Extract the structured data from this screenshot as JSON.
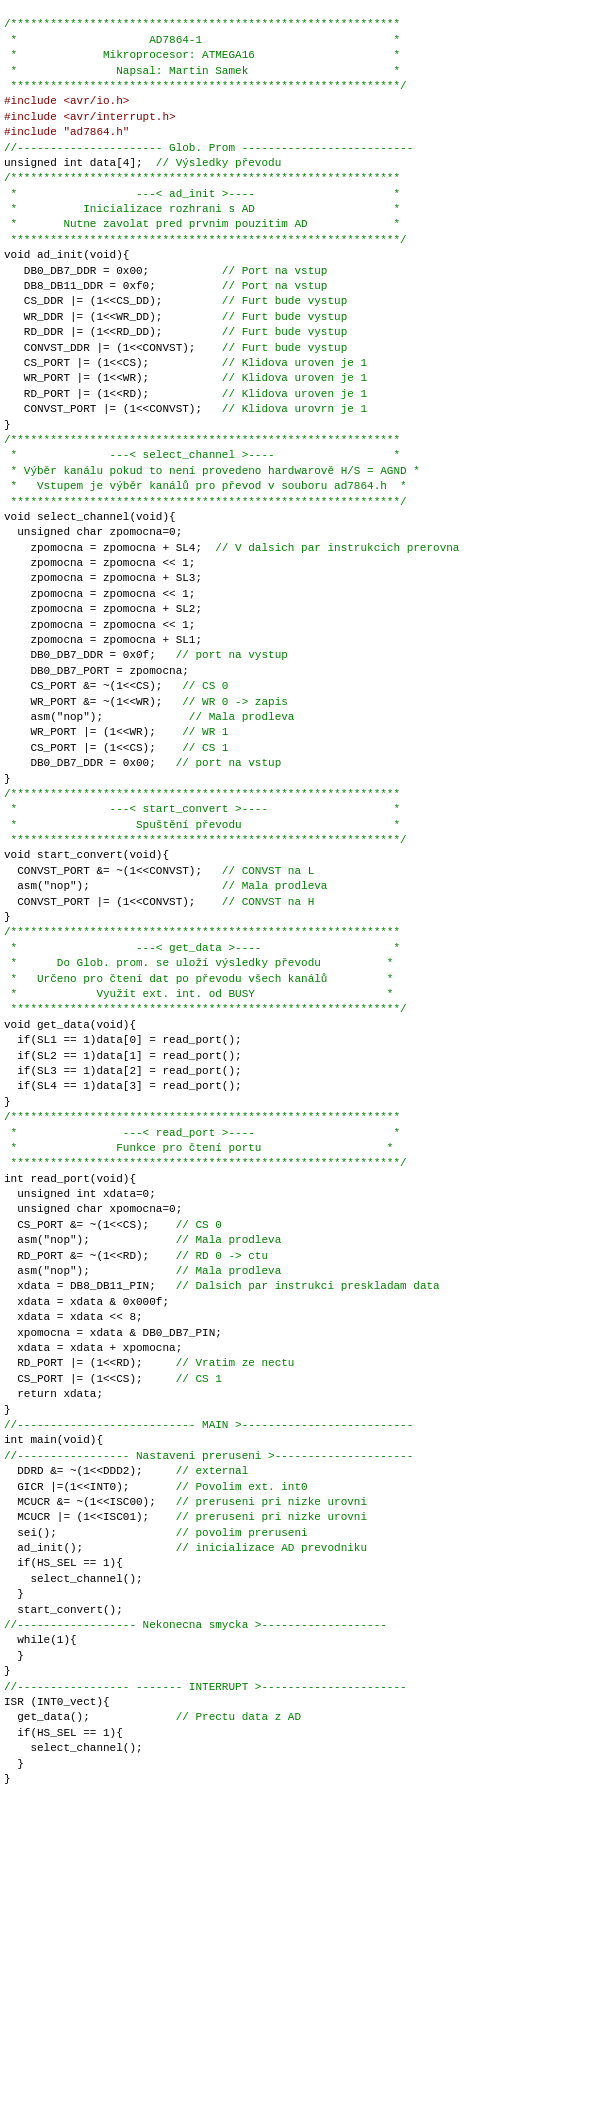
{
  "code": {
    "lines": [
      {
        "text": "/***********************************************************",
        "type": "comment"
      },
      {
        "text": " *                    AD7864-1                             *",
        "type": "comment"
      },
      {
        "text": " *             Mikroprocesor: ATMEGA16                     *",
        "type": "comment"
      },
      {
        "text": " *               Napsal: Martin Samek                      *",
        "type": "comment"
      },
      {
        "text": " ***********************************************************/",
        "type": "comment"
      },
      {
        "text": "#include <avr/io.h>",
        "type": "preprocessor"
      },
      {
        "text": "#include <avr/interrupt.h>",
        "type": "preprocessor"
      },
      {
        "text": "#include \"ad7864.h\"",
        "type": "preprocessor"
      },
      {
        "text": "",
        "type": "normal"
      },
      {
        "text": "//---------------------- Glob. Prom --------------------------",
        "type": "comment"
      },
      {
        "text": "unsigned int data[4];  // Výsledky převodu",
        "type": "normal"
      },
      {
        "text": "",
        "type": "normal"
      },
      {
        "text": "/***********************************************************",
        "type": "comment"
      },
      {
        "text": " *                  ---< ad_init >----                     *",
        "type": "comment"
      },
      {
        "text": " *          Inicializace rozhrani s AD                     *",
        "type": "comment"
      },
      {
        "text": " *       Nutne zavolat pred prvnim pouzitim AD             *",
        "type": "comment"
      },
      {
        "text": " ***********************************************************/",
        "type": "comment"
      },
      {
        "text": "",
        "type": "normal"
      },
      {
        "text": "void ad_init(void){",
        "type": "normal"
      },
      {
        "text": "",
        "type": "normal"
      },
      {
        "text": "   DB0_DB7_DDR = 0x00;           // Port na vstup",
        "type": "normal"
      },
      {
        "text": "   DB8_DB11_DDR = 0xf0;          // Port na vstup",
        "type": "normal"
      },
      {
        "text": "   CS_DDR |= (1<<CS_DD);         // Furt bude vystup",
        "type": "normal"
      },
      {
        "text": "   WR_DDR |= (1<<WR_DD);         // Furt bude vystup",
        "type": "normal"
      },
      {
        "text": "   RD_DDR |= (1<<RD_DD);         // Furt bude vystup",
        "type": "normal"
      },
      {
        "text": "   CONVST_DDR |= (1<<CONVST);    // Furt bude vystup",
        "type": "normal"
      },
      {
        "text": "   CS_PORT |= (1<<CS);           // Klidova uroven je 1",
        "type": "normal"
      },
      {
        "text": "   WR_PORT |= (1<<WR);           // Klidova uroven je 1",
        "type": "normal"
      },
      {
        "text": "   RD_PORT |= (1<<RD);           // Klidova uroven je 1",
        "type": "normal"
      },
      {
        "text": "   CONVST_PORT |= (1<<CONVST);   // Klidova urovrn je 1",
        "type": "normal"
      },
      {
        "text": "}",
        "type": "normal"
      },
      {
        "text": "/***********************************************************",
        "type": "comment"
      },
      {
        "text": " *              ---< select_channel >----                  *",
        "type": "comment"
      },
      {
        "text": " * Výběr kanálu pokud to není provedeno hardwarově H/S = AGND *",
        "type": "comment"
      },
      {
        "text": " *   Vstupem je výběr kanálů pro převod v souboru ad7864.h  *",
        "type": "comment"
      },
      {
        "text": " ***********************************************************/",
        "type": "comment"
      },
      {
        "text": "",
        "type": "normal"
      },
      {
        "text": "void select_channel(void){",
        "type": "normal"
      },
      {
        "text": "",
        "type": "normal"
      },
      {
        "text": "  unsigned char zpomocna=0;",
        "type": "normal"
      },
      {
        "text": "",
        "type": "normal"
      },
      {
        "text": "    zpomocna = zpomocna + SL4;  // V dalsich par instrukcich prerovna",
        "type": "normal"
      },
      {
        "text": "    zpomocna = zpomocna << 1;",
        "type": "normal"
      },
      {
        "text": "    zpomocna = zpomocna + SL3;",
        "type": "normal"
      },
      {
        "text": "    zpomocna = zpomocna << 1;",
        "type": "normal"
      },
      {
        "text": "    zpomocna = zpomocna + SL2;",
        "type": "normal"
      },
      {
        "text": "    zpomocna = zpomocna << 1;",
        "type": "normal"
      },
      {
        "text": "    zpomocna = zpomocna + SL1;",
        "type": "normal"
      },
      {
        "text": "    DB0_DB7_DDR = 0x0f;   // port na vystup",
        "type": "normal"
      },
      {
        "text": "    DB0_DB7_PORT = zpomocna;",
        "type": "normal"
      },
      {
        "text": "    CS_PORT &= ~(1<<CS);   // CS 0",
        "type": "normal"
      },
      {
        "text": "    WR_PORT &= ~(1<<WR);   // WR 0 -> zapis",
        "type": "normal"
      },
      {
        "text": "    asm(\"nop\");             // Mala prodleva",
        "type": "normal"
      },
      {
        "text": "    WR_PORT |= (1<<WR);    // WR 1",
        "type": "normal"
      },
      {
        "text": "    CS_PORT |= (1<<CS);    // CS 1",
        "type": "normal"
      },
      {
        "text": "    DB0_DB7_DDR = 0x00;   // port na vstup",
        "type": "normal"
      },
      {
        "text": "}",
        "type": "normal"
      },
      {
        "text": "",
        "type": "normal"
      },
      {
        "text": "",
        "type": "normal"
      },
      {
        "text": "/***********************************************************",
        "type": "comment"
      },
      {
        "text": " *              ---< start_convert >----                   *",
        "type": "comment"
      },
      {
        "text": " *                  Spuštění převodu                       *",
        "type": "comment"
      },
      {
        "text": " ***********************************************************/",
        "type": "comment"
      },
      {
        "text": "",
        "type": "normal"
      },
      {
        "text": "void start_convert(void){",
        "type": "normal"
      },
      {
        "text": "",
        "type": "normal"
      },
      {
        "text": "  CONVST_PORT &= ~(1<<CONVST);   // CONVST na L",
        "type": "normal"
      },
      {
        "text": "  asm(\"nop\");                    // Mala prodleva",
        "type": "normal"
      },
      {
        "text": "  CONVST_PORT |= (1<<CONVST);    // CONVST na H",
        "type": "normal"
      },
      {
        "text": "}",
        "type": "normal"
      },
      {
        "text": "",
        "type": "normal"
      },
      {
        "text": "",
        "type": "normal"
      },
      {
        "text": "/***********************************************************",
        "type": "comment"
      },
      {
        "text": " *                  ---< get_data >----                    *",
        "type": "comment"
      },
      {
        "text": " *      Do Glob. prom. se uloží výsledky převodu          *",
        "type": "comment"
      },
      {
        "text": " *   Určeno pro čtení dat po převodu všech kanálů         *",
        "type": "comment"
      },
      {
        "text": " *            Využít ext. int. od BUSY                    *",
        "type": "comment"
      },
      {
        "text": " ***********************************************************/",
        "type": "comment"
      },
      {
        "text": "",
        "type": "normal"
      },
      {
        "text": "void get_data(void){",
        "type": "normal"
      },
      {
        "text": "",
        "type": "normal"
      },
      {
        "text": "  if(SL1 == 1)data[0] = read_port();",
        "type": "normal"
      },
      {
        "text": "  if(SL2 == 1)data[1] = read_port();",
        "type": "normal"
      },
      {
        "text": "  if(SL3 == 1)data[2] = read_port();",
        "type": "normal"
      },
      {
        "text": "  if(SL4 == 1)data[3] = read_port();",
        "type": "normal"
      },
      {
        "text": "}",
        "type": "normal"
      },
      {
        "text": "",
        "type": "normal"
      },
      {
        "text": "",
        "type": "normal"
      },
      {
        "text": "/***********************************************************",
        "type": "comment"
      },
      {
        "text": " *                ---< read_port >----                     *",
        "type": "comment"
      },
      {
        "text": " *               Funkce pro čtení portu                   *",
        "type": "comment"
      },
      {
        "text": " ***********************************************************/",
        "type": "comment"
      },
      {
        "text": "",
        "type": "normal"
      },
      {
        "text": "int read_port(void){",
        "type": "normal"
      },
      {
        "text": "",
        "type": "normal"
      },
      {
        "text": "  unsigned int xdata=0;",
        "type": "normal"
      },
      {
        "text": "  unsigned char xpomocna=0;",
        "type": "normal"
      },
      {
        "text": "",
        "type": "normal"
      },
      {
        "text": "  CS_PORT &= ~(1<<CS);    // CS 0",
        "type": "normal"
      },
      {
        "text": "  asm(\"nop\");             // Mala prodleva",
        "type": "normal"
      },
      {
        "text": "  RD_PORT &= ~(1<<RD);    // RD 0 -> ctu",
        "type": "normal"
      },
      {
        "text": "  asm(\"nop\");             // Mala prodleva",
        "type": "normal"
      },
      {
        "text": "  xdata = DB8_DB11_PIN;   // Dalsich par instrukci preskladam data",
        "type": "normal"
      },
      {
        "text": "  xdata = xdata & 0x000f;",
        "type": "normal"
      },
      {
        "text": "  xdata = xdata << 8;",
        "type": "normal"
      },
      {
        "text": "  xpomocna = xdata & DB0_DB7_PIN;",
        "type": "normal"
      },
      {
        "text": "  xdata = xdata + xpomocna;",
        "type": "normal"
      },
      {
        "text": "  RD_PORT |= (1<<RD);     // Vratim ze nectu",
        "type": "normal"
      },
      {
        "text": "  CS_PORT |= (1<<CS);     // CS 1",
        "type": "normal"
      },
      {
        "text": "  return xdata;",
        "type": "normal"
      },
      {
        "text": "}",
        "type": "normal"
      },
      {
        "text": "//--------------------------- MAIN >--------------------------",
        "type": "comment"
      },
      {
        "text": "int main(void){",
        "type": "normal"
      },
      {
        "text": "//----------------- Nastaveni preruseni >---------------------",
        "type": "comment"
      },
      {
        "text": "  DDRD &= ~(1<<DDD2);     // external",
        "type": "normal"
      },
      {
        "text": "  GICR |=(1<<INT0);       // Povolim ext. int0",
        "type": "normal"
      },
      {
        "text": "  MCUCR &= ~(1<<ISC00);   // preruseni pri nizke urovni",
        "type": "normal"
      },
      {
        "text": "  MCUCR |= (1<<ISC01);    // preruseni pri nizke urovni",
        "type": "normal"
      },
      {
        "text": "  sei();                  // povolim preruseni",
        "type": "normal"
      },
      {
        "text": "  ad_init();              // inicializace AD prevodniku",
        "type": "normal"
      },
      {
        "text": "  if(HS_SEL == 1){",
        "type": "normal"
      },
      {
        "text": "    select_channel();",
        "type": "normal"
      },
      {
        "text": "  }",
        "type": "normal"
      },
      {
        "text": "  start_convert();",
        "type": "normal"
      },
      {
        "text": "//------------------ Nekonecna smycka >-------------------",
        "type": "comment"
      },
      {
        "text": "  while(1){",
        "type": "normal"
      },
      {
        "text": "  }",
        "type": "normal"
      },
      {
        "text": "}",
        "type": "normal"
      },
      {
        "text": "//----------------- ------- INTERRUPT >----------------------",
        "type": "comment"
      },
      {
        "text": "ISR (INT0_vect){",
        "type": "normal"
      },
      {
        "text": "  get_data();             // Prectu data z AD",
        "type": "normal"
      },
      {
        "text": "  if(HS_SEL == 1){",
        "type": "normal"
      },
      {
        "text": "    select_channel();",
        "type": "normal"
      },
      {
        "text": "  }",
        "type": "normal"
      },
      {
        "text": "}",
        "type": "normal"
      }
    ]
  }
}
